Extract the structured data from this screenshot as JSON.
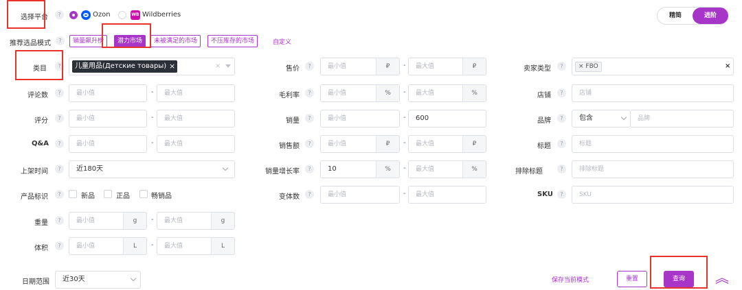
{
  "platform": {
    "label": "选择平台",
    "options": [
      {
        "name": "Ozon",
        "selected": true
      },
      {
        "name": "Wildberries",
        "selected": false
      }
    ]
  },
  "view_mode": {
    "options": [
      "精简",
      "进阶"
    ],
    "active": "进阶"
  },
  "strategy": {
    "label": "推荐选品模式",
    "tags": [
      "销量飙升榜",
      "潜力市场",
      "未被满足的市场",
      "不压库存的市场"
    ],
    "active_tag": "潜力市场",
    "custom_link": "自定义"
  },
  "category": {
    "label": "类目",
    "value": "儿童用品(Детские товары)"
  },
  "placeholders": {
    "min": "最小值",
    "max": "最大值"
  },
  "left_fields": {
    "reviews": {
      "label": "评论数"
    },
    "rating": {
      "label": "评分"
    },
    "qa": {
      "label": "Q&A"
    },
    "listing_time": {
      "label": "上架时间",
      "value": "近180天"
    },
    "product_tags": {
      "label": "产品标识",
      "options": [
        "新品",
        "正品",
        "畅销品"
      ]
    },
    "weight": {
      "label": "重量",
      "unit": "g"
    },
    "volume": {
      "label": "体积",
      "unit": "L"
    }
  },
  "mid_fields": {
    "price": {
      "label": "售价",
      "unit": "₽"
    },
    "margin": {
      "label": "毛利率",
      "unit": "%"
    },
    "sales": {
      "label": "销量",
      "max_value": "600"
    },
    "revenue": {
      "label": "销售额",
      "unit": "₽"
    },
    "growth": {
      "label": "销量增长率",
      "min_value": "10",
      "unit": "%"
    },
    "variants": {
      "label": "变体数"
    }
  },
  "right_fields": {
    "seller_type": {
      "label": "卖家类型",
      "chip": "× FBO",
      "clear": "×"
    },
    "shop": {
      "label": "店铺",
      "placeholder": "店铺"
    },
    "brand": {
      "label": "品牌",
      "mode": "包含",
      "placeholder": "品牌"
    },
    "title": {
      "label": "标题",
      "placeholder": "标题"
    },
    "exclude_title": {
      "label": "排除标题",
      "placeholder": "排除标题"
    },
    "sku": {
      "label": "SKU",
      "placeholder": "SKU"
    }
  },
  "date_range": {
    "label": "日期范围",
    "value": "近30天"
  },
  "actions": {
    "save_mode": "保存当前模式",
    "reset": "重置",
    "query": "查询",
    "collapse": "︽"
  },
  "help_glyph": "?",
  "colors": {
    "accent": "#a735c8",
    "ozon": "#005bff",
    "wildberries": "#cb11ab",
    "highlight": "#e8322a"
  }
}
